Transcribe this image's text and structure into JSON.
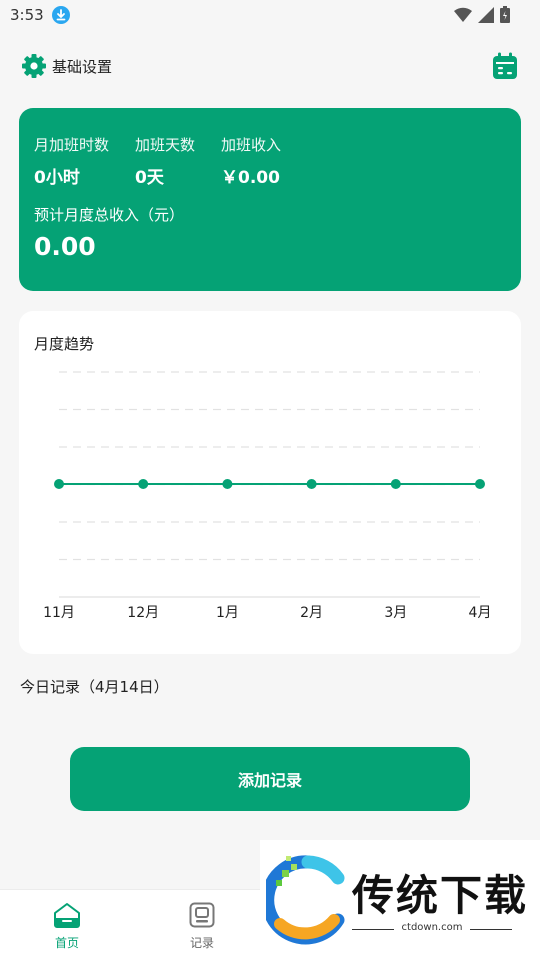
{
  "status_bar": {
    "time": "3:53"
  },
  "header": {
    "settings_label": "基础设置"
  },
  "summary": {
    "overtime_hours_label": "月加班时数",
    "overtime_hours_value": "0小时",
    "overtime_days_label": "加班天数",
    "overtime_days_value": "0天",
    "overtime_income_label": "加班收入",
    "overtime_income_value": "￥0.00",
    "total_label": "预计月度总收入（元）",
    "total_value": "0.00"
  },
  "chart": {
    "title": "月度趋势"
  },
  "chart_data": {
    "type": "line",
    "title": "月度趋势",
    "categories": [
      "11月",
      "12月",
      "1月",
      "2月",
      "3月",
      "4月"
    ],
    "series": [
      {
        "values": [
          0,
          0,
          0,
          0,
          0,
          0
        ]
      }
    ],
    "grid": true,
    "color": "#05a275"
  },
  "today": {
    "title": "今日记录（4月14日）"
  },
  "actions": {
    "add_label": "添加记录"
  },
  "nav": {
    "items": [
      {
        "label": "首页",
        "icon": "home-icon",
        "active": true
      },
      {
        "label": "记录",
        "icon": "record-icon",
        "active": false
      }
    ]
  },
  "watermark": {
    "text": "传统下载",
    "url": "ctdown.com"
  },
  "colors": {
    "accent": "#05a275",
    "background": "#f6f6f6"
  }
}
